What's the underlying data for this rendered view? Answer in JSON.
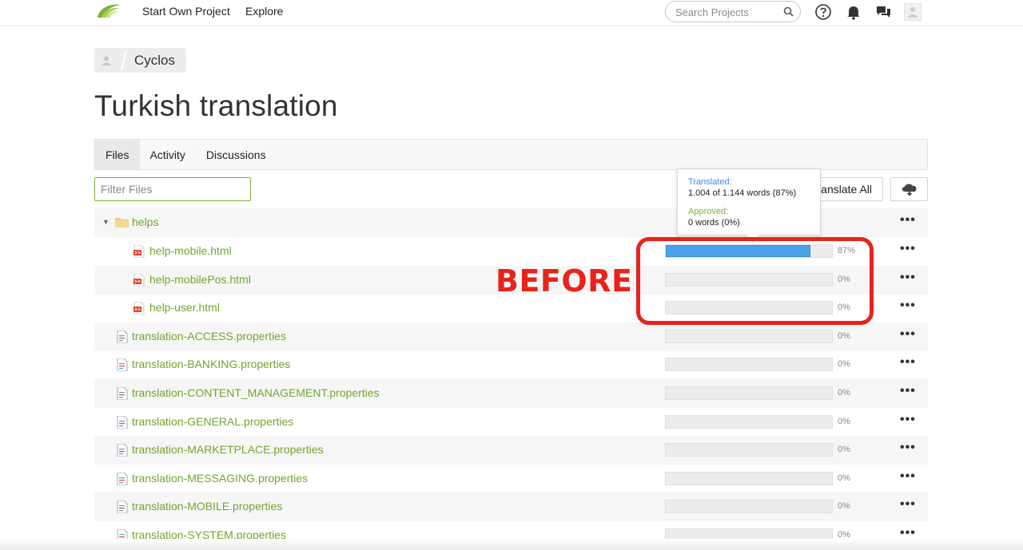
{
  "nav": {
    "start_project": "Start Own Project",
    "explore": "Explore",
    "search_placeholder": "Search Projects"
  },
  "breadcrumb": {
    "project": "Cyclos"
  },
  "page_title": "Turkish translation",
  "tabs": [
    {
      "label": "Files",
      "active": true
    },
    {
      "label": "Activity",
      "active": false
    },
    {
      "label": "Discussions",
      "active": false
    }
  ],
  "filter_placeholder": "Filter Files",
  "translate_all_label": "Translate All",
  "tooltip": {
    "translated_label": "Translated:",
    "translated_value": "1.004 of 1.144 words (87%)",
    "approved_label": "Approved:",
    "approved_value": "0 words (0%)"
  },
  "annotation": "BEFORE",
  "folder": {
    "name": "helps"
  },
  "files": [
    {
      "name": "help-mobile.html",
      "progress": 87,
      "pct": "87%",
      "type": "html",
      "in_folder": true
    },
    {
      "name": "help-mobilePos.html",
      "progress": 0,
      "pct": "0%",
      "type": "html",
      "in_folder": true
    },
    {
      "name": "help-user.html",
      "progress": 0,
      "pct": "0%",
      "type": "html",
      "in_folder": true
    },
    {
      "name": "translation-ACCESS.properties",
      "progress": 0,
      "pct": "0%",
      "type": "properties",
      "in_folder": false
    },
    {
      "name": "translation-BANKING.properties",
      "progress": 0,
      "pct": "0%",
      "type": "properties",
      "in_folder": false
    },
    {
      "name": "translation-CONTENT_MANAGEMENT.properties",
      "progress": 0,
      "pct": "0%",
      "type": "properties",
      "in_folder": false
    },
    {
      "name": "translation-GENERAL.properties",
      "progress": 0,
      "pct": "0%",
      "type": "properties",
      "in_folder": false
    },
    {
      "name": "translation-MARKETPLACE.properties",
      "progress": 0,
      "pct": "0%",
      "type": "properties",
      "in_folder": false
    },
    {
      "name": "translation-MESSAGING.properties",
      "progress": 0,
      "pct": "0%",
      "type": "properties",
      "in_folder": false
    },
    {
      "name": "translation-MOBILE.properties",
      "progress": 0,
      "pct": "0%",
      "type": "properties",
      "in_folder": false
    },
    {
      "name": "translation-SYSTEM.properties",
      "progress": 0,
      "pct": "0%",
      "type": "properties",
      "in_folder": false
    }
  ],
  "more_label": "•••",
  "colors": {
    "brand_green": "#6fa72f",
    "progress_blue": "#4aa3e8",
    "annotation_red": "#e8231c",
    "tooltip_translated": "#3f8fd2",
    "tooltip_approved": "#7fb135"
  }
}
